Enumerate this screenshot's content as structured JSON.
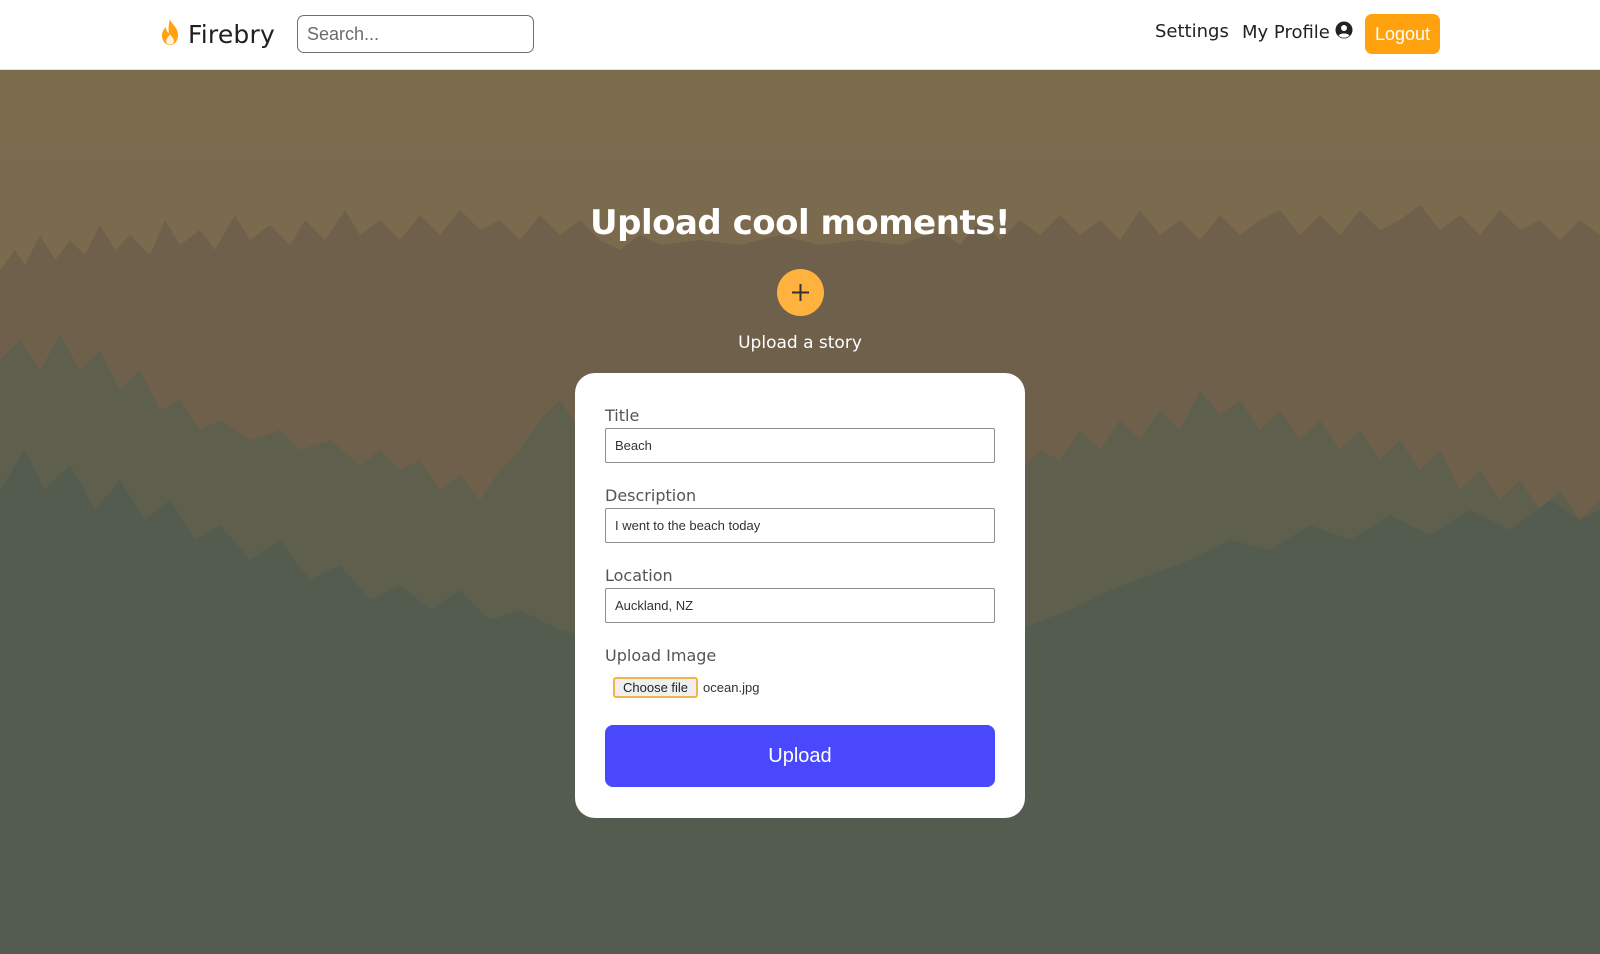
{
  "header": {
    "brand": "Firebry",
    "search_placeholder": "Search...",
    "nav": {
      "settings": "Settings",
      "my_profile": "My Profile",
      "logout": "Logout"
    }
  },
  "hero": {
    "heading": "Upload cool moments!",
    "upload_story": "Upload a story"
  },
  "form": {
    "title_label": "Title",
    "title_value": "Beach",
    "description_label": "Description",
    "description_value": "I went to the beach today",
    "location_label": "Location",
    "location_value": "Auckland, NZ",
    "image_label": "Upload Image",
    "choose_file": "Choose file",
    "file_name": "ocean.jpg",
    "submit": "Upload"
  },
  "colors": {
    "accent": "#ffa20d",
    "plus_button": "#ffb23e",
    "submit_button": "#4a48fc",
    "sky": "#7b6c4e",
    "forest": "#505a4f"
  },
  "icons": {
    "brand": "flame-icon",
    "profile": "user-circle-icon",
    "plus": "plus-icon"
  }
}
